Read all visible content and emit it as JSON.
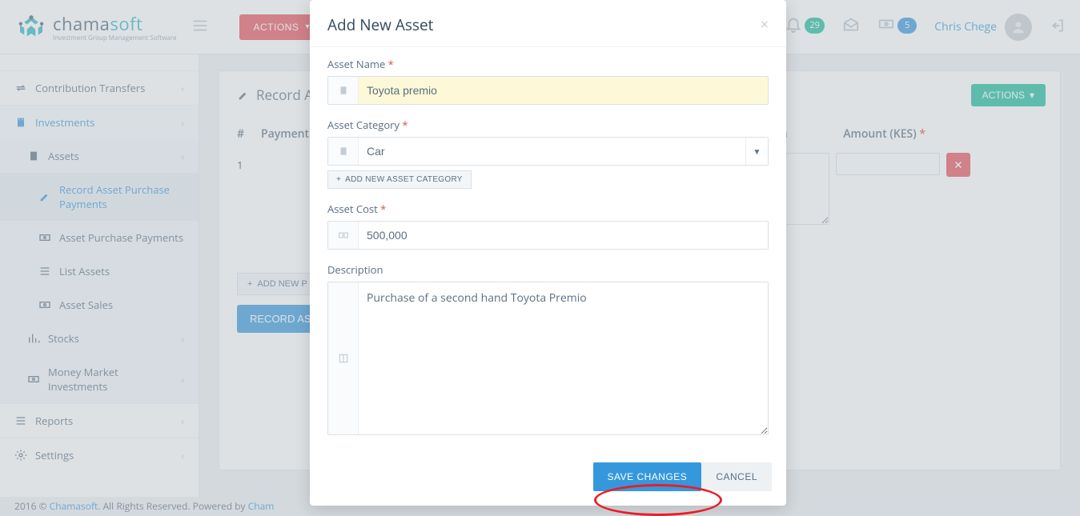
{
  "brand": {
    "name_a": "chama",
    "name_b": "soft",
    "tagline": "Investment Group Management Software"
  },
  "header": {
    "actions_label": "ACTIONS",
    "notif_count": "29",
    "money_count": "5",
    "user_name": "Chris Chege"
  },
  "sidebar": {
    "items": [
      {
        "label": "Contribution Transfers"
      },
      {
        "label": "Investments"
      }
    ],
    "assets_label": "Assets",
    "sub": [
      {
        "label": "Record Asset Purchase Payments"
      },
      {
        "label": "Asset Purchase Payments"
      },
      {
        "label": "List Assets"
      },
      {
        "label": "Asset Sales"
      }
    ],
    "more": [
      {
        "label": "Stocks"
      },
      {
        "label": "Money Market Investments"
      }
    ],
    "bottom": [
      {
        "label": "Reports"
      },
      {
        "label": "Settings"
      }
    ]
  },
  "panel": {
    "page_title_prefix": "Record As",
    "actions_label": "ACTIONS",
    "col_num": "#",
    "col_payment": "Payment",
    "col_desc": "Description",
    "col_amount": "Amount (KES)",
    "row1": "1",
    "add_row_prefix": "ADD NEW P",
    "submit_label": "RECORD ASS"
  },
  "modal": {
    "title": "Add New Asset",
    "f1_label": "Asset Name",
    "f1_value": "Toyota premio",
    "f2_label": "Asset Category",
    "f2_value": "Car",
    "add_cat_label": "ADD NEW ASSET CATEGORY",
    "f3_label": "Asset Cost",
    "f3_value": "500,000",
    "f4_label": "Description",
    "f4_value": "Purchase of a second hand Toyota Premio",
    "save_label": "SAVE CHANGES",
    "cancel_label": "CANCEL"
  },
  "footer": {
    "year": "2016 © ",
    "brand": "Chamasoft",
    "middle": ". All Rights Reserved. Powered by ",
    "brand2": "Cham"
  }
}
